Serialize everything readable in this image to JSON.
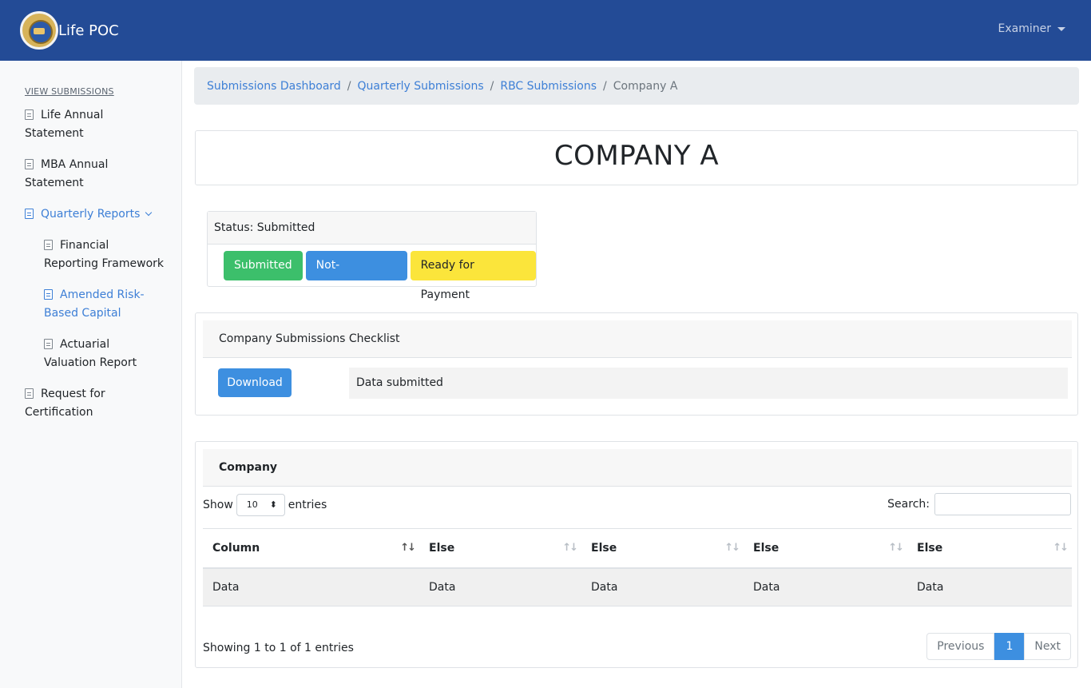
{
  "navbar": {
    "brand": "Life POC",
    "user_menu": "Examiner"
  },
  "sidebar": {
    "heading": "VIEW SUBMISSIONS",
    "items": [
      {
        "label": "Life Annual Statement"
      },
      {
        "label": "MBA Annual Statement"
      },
      {
        "label": "Quarterly Reports"
      },
      {
        "label": "Financial Reporting Framework"
      },
      {
        "label": "Amended Risk-Based Capital"
      },
      {
        "label": "Actuarial Valuation Report"
      },
      {
        "label": "Request for Certification"
      }
    ],
    "split": {
      "life1": "Life Annual",
      "life2": "Statement",
      "mba1": "MBA Annual",
      "mba2": "Statement",
      "fin1": "Financial",
      "fin2": "Reporting Framework",
      "rbc1": "Amended Risk-",
      "rbc2": "Based Capital",
      "act1": "Actuarial",
      "act2": "Valuation Report",
      "req1": "Request for",
      "req2": "Certification"
    }
  },
  "breadcrumb": {
    "items": [
      "Submissions Dashboard",
      "Quarterly Submissions",
      "RBC Submissions"
    ],
    "current": "Company A"
  },
  "company_title": "COMPANY A",
  "status": {
    "label": "Status: Submitted",
    "buttons": [
      "Submitted",
      "Not-Submitted",
      "Ready for Payment"
    ]
  },
  "checklist": {
    "title": "Company Submissions Checklist",
    "download_label": "Download",
    "status_text": "Data submitted"
  },
  "table": {
    "title": "Company",
    "show_label": "Show",
    "entries_value": "10",
    "entries_label": "entries",
    "search_label": "Search:",
    "columns": [
      "Column",
      "Else",
      "Else",
      "Else",
      "Else"
    ],
    "rows": [
      [
        "Data",
        "Data",
        "Data",
        "Data",
        "Data"
      ]
    ],
    "info": "Showing 1 to 1 of 1 entries",
    "pagination": {
      "previous": "Previous",
      "page": "1",
      "next": "Next"
    }
  },
  "colors": {
    "navbar": "#234b96",
    "accent": "#3d8fe0",
    "success": "#3cbf6b",
    "warning": "#fbe53b"
  }
}
